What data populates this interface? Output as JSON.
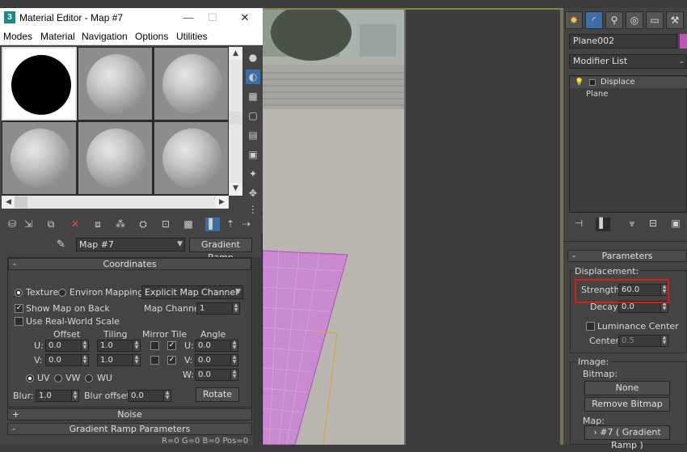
{
  "material_editor": {
    "title": "Material Editor - Map #7",
    "window_controls": {
      "minimize": "—",
      "maximize": "☐",
      "close": "✕"
    },
    "menu": [
      "Modes",
      "Material",
      "Navigation",
      "Options",
      "Utilities"
    ],
    "map_name": "Map #7",
    "map_type_button": "Gradient Ramp",
    "coordinates": {
      "rollout_title": "Coordinates",
      "texture_label": "Texture",
      "environ_label": "Environ",
      "mapping_label": "Mapping:",
      "mapping_value": "Explicit Map Channel",
      "show_map_on_back": "Show Map on Back",
      "use_real_world_scale": "Use Real-World Scale",
      "map_channel_label": "Map Channel:",
      "map_channel_value": "1",
      "offset_header": "Offset",
      "tiling_header": "Tiling",
      "mirror_tile_header": "Mirror Tile",
      "angle_header": "Angle",
      "u_label": "U:",
      "v_label": "V:",
      "w_label": "W:",
      "offset_u": "0.0",
      "offset_v": "0.0",
      "tiling_u": "1.0",
      "tiling_v": "1.0",
      "angle_u": "0.0",
      "angle_v": "0.0",
      "angle_w": "0.0",
      "uv_label": "UV",
      "vw_label": "VW",
      "wu_label": "WU",
      "blur_label": "Blur:",
      "blur_value": "1.0",
      "blur_offset_label": "Blur offset:",
      "blur_offset_value": "0.0",
      "rotate_button": "Rotate"
    },
    "noise_rollout": "Noise",
    "gradient_ramp_rollout": "Gradient Ramp Parameters",
    "ramp_readout": "R=0 G=0 B=0  Pos=0"
  },
  "command_panel": {
    "object_name": "Plane002",
    "modifier_list_label": "Modifier List",
    "stack": [
      {
        "label": "Displace"
      },
      {
        "label": "Plane"
      }
    ],
    "parameters_rollout": "Parameters",
    "displacement_group": "Displacement:",
    "strength_label": "Strength:",
    "strength_value": "60.0",
    "decay_label": "Decay:",
    "decay_value": "0.0",
    "luminance_center_label": "Luminance Center",
    "center_label": "Center:",
    "center_value": "0.5",
    "image_group": "Image:",
    "bitmap_label": "Bitmap:",
    "bitmap_button": "None",
    "remove_bitmap_button": "Remove Bitmap",
    "map_label": "Map:",
    "map_button": "› #7  ( Gradient Ramp )",
    "object_color": "#c84fc0"
  }
}
